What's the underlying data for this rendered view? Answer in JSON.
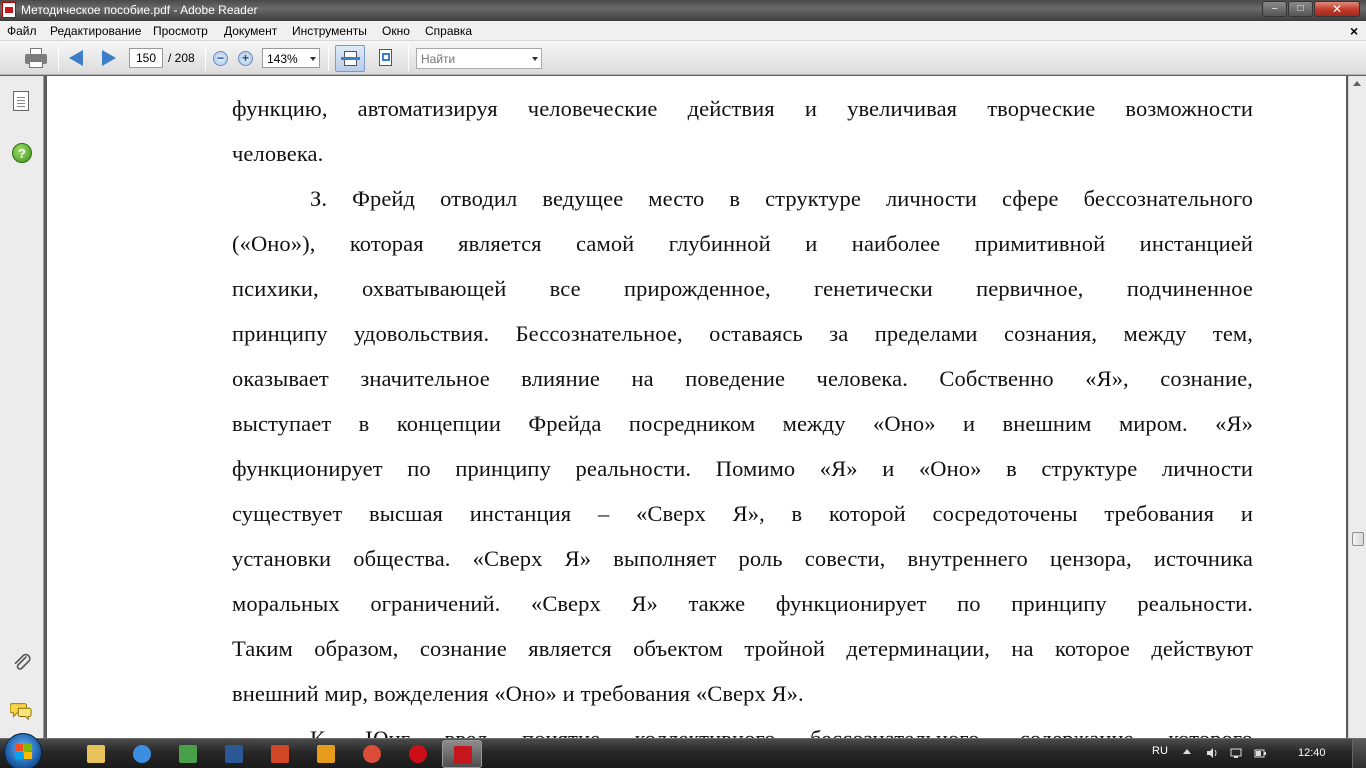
{
  "window": {
    "title": "Методическое пособие.pdf - Adobe Reader",
    "minimize": "–",
    "maximize": "□",
    "close": "✕"
  },
  "menu": {
    "items": [
      "Файл",
      "Редактирование",
      "Просмотр",
      "Документ",
      "Инструменты",
      "Окно",
      "Справка"
    ],
    "close_doc": "×"
  },
  "toolbar": {
    "page_current": "150",
    "page_total": "/ 208",
    "zoom": "143%",
    "zoom_out": "−",
    "zoom_in": "+",
    "search_placeholder": "Найти"
  },
  "icons": {
    "print": "printer-icon",
    "prev": "arrow-left-icon",
    "next": "arrow-right-icon",
    "fit_width": "fit-width-icon",
    "fit_page": "fit-page-icon",
    "pages": "pages-icon",
    "help": "help-icon",
    "attachments": "paperclip-icon",
    "comments": "comments-icon"
  },
  "navpanel": {
    "help_symbol": "?"
  },
  "document": {
    "lines": [
      "функцию, автоматизируя человеческие действия и увеличивая творческие возможности",
      "человека.",
      "З. Фрейд отводил ведущее место в структуре личности сфере бессознательного",
      "(«Оно»), которая является самой глубинной и наиболее примитивной инстанцией",
      "психики, охватывающей все прирожденное, генетически первичное, подчиненное",
      "принципу удовольствия. Бессознательное, оставаясь за пределами сознания, между тем,",
      "оказывает значительное влияние на поведение человека. Собственно «Я», сознание,",
      "выступает в концепции Фрейда посредником между «Оно» и внешним миром. «Я»",
      "функционирует по принципу реальности. Помимо «Я» и «Оно» в структуре личности",
      "существует высшая инстанция – «Сверх Я», в которой сосредоточены требования и",
      "установки общества. «Сверх Я» выполняет роль совести, внутреннего цензора, источника",
      "моральных ограничений. «Сверх Я» также функционирует по принципу реальности.",
      "Таким образом, сознание является объектом тройной детерминации, на которое действуют",
      "внешний мир, вожделения «Оно» и требования «Сверх Я».",
      "К. Юнг ввел понятие коллективного бессознательного, содержание которого"
    ]
  },
  "taskbar": {
    "language": "RU",
    "time": "12:40",
    "apps": [
      {
        "name": "explorer",
        "color": "#e8c25a"
      },
      {
        "name": "internet-explorer",
        "color": "#3c8ee0"
      },
      {
        "name": "media-app",
        "color": "#4aa04a"
      },
      {
        "name": "word",
        "color": "#2b5797"
      },
      {
        "name": "presentation-app",
        "color": "#d24726"
      },
      {
        "name": "media-player",
        "color": "#e89b1a"
      },
      {
        "name": "chrome",
        "color": "#dd4b39"
      },
      {
        "name": "opera",
        "color": "#cc0f16"
      },
      {
        "name": "adobe-reader",
        "color": "#c4161c"
      }
    ]
  }
}
